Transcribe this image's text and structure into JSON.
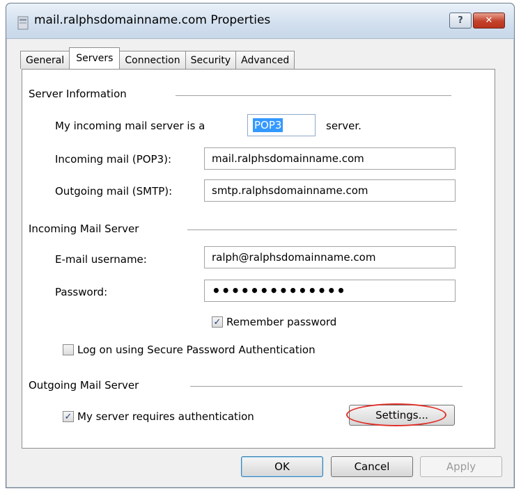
{
  "window": {
    "title": "mail.ralphsdomainname.com Properties",
    "help_label": "?",
    "close_label": "✕"
  },
  "tabs": [
    {
      "label": "General"
    },
    {
      "label": "Servers",
      "active": true
    },
    {
      "label": "Connection"
    },
    {
      "label": "Security"
    },
    {
      "label": "Advanced"
    }
  ],
  "server_info": {
    "heading": "Server Information",
    "incoming_type_label": "My incoming mail server is a",
    "incoming_type_value": "POP3",
    "incoming_type_suffix": "server.",
    "incoming_label": "Incoming mail (POP3):",
    "incoming_value": "mail.ralphsdomainname.com",
    "outgoing_label": "Outgoing mail (SMTP):",
    "outgoing_value": "smtp.ralphsdomainname.com"
  },
  "incoming_server": {
    "heading": "Incoming Mail Server",
    "username_label": "E-mail username:",
    "username_value": "ralph@ralphsdomainname.com",
    "password_label": "Password:",
    "password_value": "••••••••••••••",
    "remember_label": "Remember password",
    "remember_checked": true,
    "spa_label": "Log on using Secure Password Authentication",
    "spa_checked": false
  },
  "outgoing_server": {
    "heading": "Outgoing Mail Server",
    "auth_label": "My server requires authentication",
    "auth_checked": true,
    "settings_label": "Settings..."
  },
  "footer": {
    "ok_label": "OK",
    "cancel_label": "Cancel",
    "apply_label": "Apply"
  },
  "colors": {
    "annotation_ellipse": "#e0302a",
    "selection": "#3399ff"
  }
}
